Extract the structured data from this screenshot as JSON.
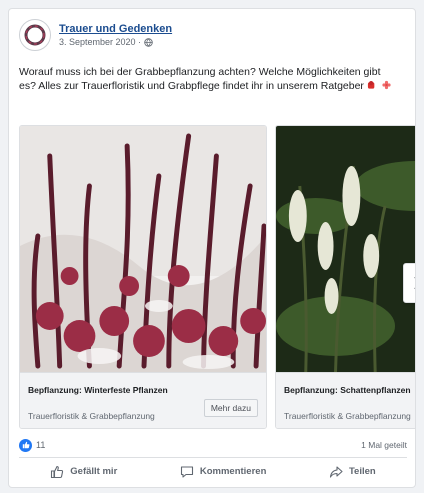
{
  "post": {
    "page_name": "Trauer und Gedenken",
    "date": "3. September 2020 ·",
    "text": "Worauf muss ich bei der Grabbepflanzung achten? Welche Möglichkeiten gibt es? Alles zur Trauerfloristik und Grabpflege findet ihr in unserem Ratgeber"
  },
  "cards": [
    {
      "title": "Bepflanzung: Winterfeste Pflanzen",
      "source": "Trauerfloristik & Grabbepflanzung",
      "button": "Mehr dazu"
    },
    {
      "title": "Bepflanzung: Schattenpflanzen",
      "source": "Trauerfloristik & Grabbepflanzung"
    }
  ],
  "stats": {
    "likes": "11",
    "shares": "1 Mal geteilt"
  },
  "actions": {
    "like": "Gefällt mir",
    "comment": "Kommentieren",
    "share": "Teilen"
  },
  "colors": {
    "link": "#1b4c8f",
    "like_blue": "#2078f4",
    "accent_red": "#d9302c"
  }
}
